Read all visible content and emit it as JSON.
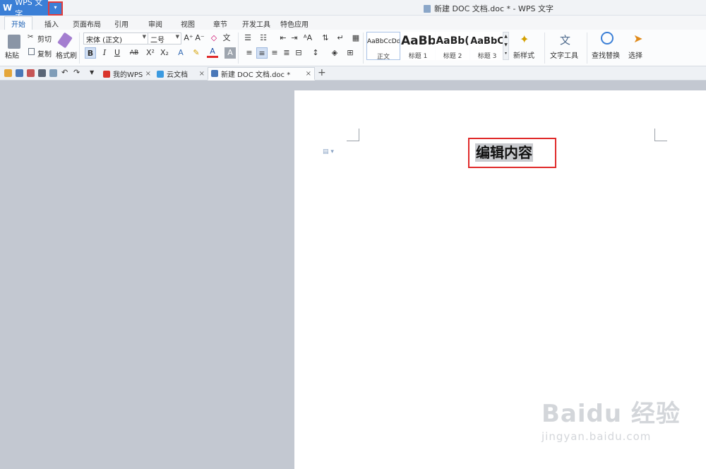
{
  "titlebar": {
    "app_label": "WPS 文字",
    "app_logo": "W",
    "dropdown_glyph": "▾",
    "window_title": "新建 DOC 文档.doc * - WPS 文字"
  },
  "menu": {
    "tabs": [
      "开始",
      "插入",
      "页面布局",
      "引用",
      "审阅",
      "视图",
      "章节",
      "开发工具",
      "特色应用"
    ],
    "active": "开始"
  },
  "ribbon": {
    "clipboard": {
      "paste": "粘贴",
      "cut": "剪切",
      "copy": "复制",
      "format_painter": "格式刷"
    },
    "font": {
      "family": "宋体 (正文)",
      "size": "二号"
    },
    "styles": [
      {
        "preview": "AaBbCcDd",
        "label": "正文"
      },
      {
        "preview": "AaBb",
        "label": "标题 1"
      },
      {
        "preview": "AaBb(",
        "label": "标题 2"
      },
      {
        "preview": "AaBbC",
        "label": "标题 3"
      }
    ],
    "new_style": "新样式",
    "text_tools": "文字工具",
    "find_replace": "查找替换",
    "select": "选择"
  },
  "doc_tabs": [
    {
      "label": "我的WPS",
      "icon": "wps-logo-icon"
    },
    {
      "label": "云文档",
      "icon": "cloud-icon"
    },
    {
      "label": "新建 DOC 文档.doc *",
      "icon": "document-icon",
      "active": true
    }
  ],
  "document": {
    "content": "编辑内容"
  },
  "watermark": {
    "brand": "Baidu 经验",
    "url": "jingyan.baidu.com"
  },
  "colors": {
    "accent": "#3b7fd6",
    "highlight_frame": "#e02a2a",
    "workspace": "#c3c8d1"
  }
}
